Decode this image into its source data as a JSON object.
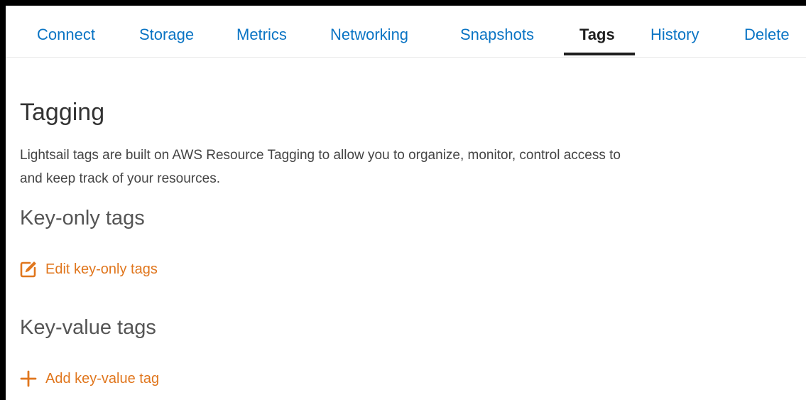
{
  "tabs": [
    {
      "label": "Connect",
      "active": false
    },
    {
      "label": "Storage",
      "active": false
    },
    {
      "label": "Metrics",
      "active": false
    },
    {
      "label": "Networking",
      "active": false
    },
    {
      "label": "Snapshots",
      "active": false
    },
    {
      "label": "Tags",
      "active": true
    },
    {
      "label": "History",
      "active": false
    },
    {
      "label": "Delete",
      "active": false
    }
  ],
  "tagging": {
    "title": "Tagging",
    "description": "Lightsail tags are built on AWS Resource Tagging to allow you to organize, monitor, control access to and keep track of your resources.",
    "key_only": {
      "title": "Key-only tags",
      "action_label": "Edit key-only tags",
      "action_icon": "edit-icon"
    },
    "key_value": {
      "title": "Key-value tags",
      "action_label": "Add key-value tag",
      "action_icon": "plus-icon"
    }
  },
  "colors": {
    "tab_link": "#0a74c4",
    "tab_active": "#1f1f1f",
    "action_orange": "#e0761d",
    "heading": "#333333"
  }
}
